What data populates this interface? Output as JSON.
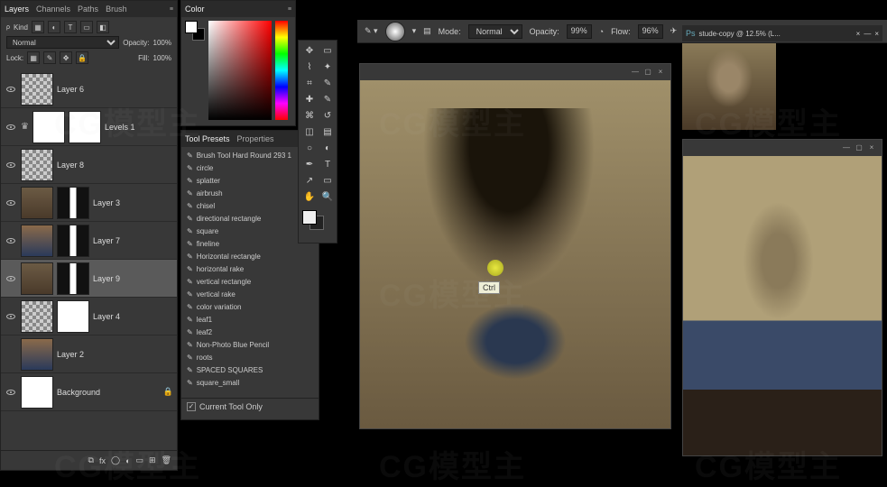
{
  "layers_panel": {
    "tabs": [
      "Layers",
      "Channels",
      "Paths",
      "Brush"
    ],
    "kind_label": "Kind",
    "blend_mode": "Normal",
    "opacity_label": "Opacity:",
    "opacity_value": "100%",
    "lock_label": "Lock:",
    "fill_label": "Fill:",
    "fill_value": "100%",
    "layers": [
      {
        "name": "Layer 6",
        "visible": true,
        "thumb": "checker",
        "mask": null
      },
      {
        "name": "Levels 1",
        "visible": true,
        "thumb": "white",
        "mask": "white",
        "adjustment": true
      },
      {
        "name": "Layer 8",
        "visible": true,
        "thumb": "checker",
        "mask": null
      },
      {
        "name": "Layer 3",
        "visible": true,
        "thumb": "portrait1",
        "mask": "bw"
      },
      {
        "name": "Layer 7",
        "visible": true,
        "thumb": "painting",
        "mask": "bw"
      },
      {
        "name": "Layer 9",
        "visible": true,
        "thumb": "portrait1",
        "mask": "bw",
        "selected": true
      },
      {
        "name": "Layer 4",
        "visible": true,
        "thumb": "checker",
        "mask": "white"
      },
      {
        "name": "Layer 2",
        "visible": false,
        "thumb": "painting",
        "mask": null
      },
      {
        "name": "Background",
        "visible": true,
        "thumb": "white",
        "mask": null,
        "locked": true
      }
    ]
  },
  "color_panel": {
    "tab": "Color"
  },
  "presets_panel": {
    "tabs": [
      "Tool Presets",
      "Properties"
    ],
    "items": [
      "Brush Tool Hard Round 293 1",
      "circle",
      "splatter",
      "airbrush",
      "chisel",
      "directional rectangle",
      "square",
      "fineline",
      "Horizontal rectangle",
      "horizontal rake",
      "vertical rectangle",
      "vertical rake",
      "color variation",
      "leaf1",
      "leaf2",
      "Non-Photo Blue Pencil",
      "roots",
      "SPACED SQUARES",
      "square_small"
    ],
    "current_only_label": "Current Tool Only",
    "current_only_checked": true
  },
  "options_bar": {
    "mode_label": "Mode:",
    "mode_value": "Normal",
    "opacity_label": "Opacity:",
    "opacity_value": "99%",
    "flow_label": "Flow:",
    "flow_value": "96%"
  },
  "doc_tab": {
    "title": "stude-copy @ 12.5% (L..."
  },
  "key_hint": "Ctrl",
  "tools": [
    "move",
    "marquee",
    "lasso",
    "wand",
    "crop",
    "eyedropper",
    "heal",
    "brush",
    "stamp",
    "history",
    "eraser",
    "gradient",
    "blur",
    "dodge",
    "pen",
    "type",
    "path",
    "shape",
    "hand",
    "zoom"
  ],
  "watermark": "CG模型主"
}
